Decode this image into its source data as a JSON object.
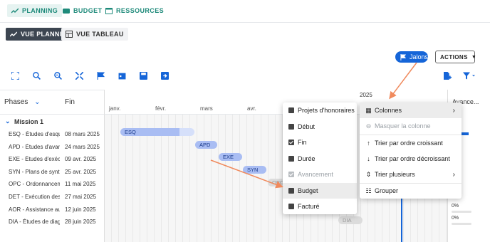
{
  "tabs": [
    {
      "label": "PLANNING",
      "icon": "trend-icon"
    },
    {
      "label": "BUDGET",
      "icon": "wallet-icon"
    },
    {
      "label": "RESSOURCES",
      "icon": "calendar-icon"
    }
  ],
  "views": {
    "gantt": "VUE PLANNING",
    "table": "VUE TABLEAU"
  },
  "toolbar": {
    "jalons": "Jalons",
    "actions": "ACTIONS"
  },
  "grid": {
    "phases_header": "Phases",
    "fin_header": "Fin",
    "year": "2025",
    "progress_header": "Avance...",
    "months": [
      "janv.",
      "févr.",
      "mars",
      "avr."
    ],
    "mission": "Mission 1",
    "rows": [
      {
        "phase": "ESQ - Études d'esquisse",
        "fin": "08 mars 2025",
        "bar": "ESQ"
      },
      {
        "phase": "APD - Études d'avant-projet",
        "fin": "24 mars 2025",
        "bar": "APD"
      },
      {
        "phase": "EXE - Études d'exécution",
        "fin": "09 avr. 2025",
        "bar": "EXE"
      },
      {
        "phase": "SYN - Plans de synthèse",
        "fin": "25 avr. 2025",
        "bar": "SYN"
      },
      {
        "phase": "OPC - Ordonnancement",
        "fin": "11 mai 2025",
        "bar": "OPC"
      },
      {
        "phase": "DET - Exécution des contrats",
        "fin": "27 mai 2025",
        "bar": ""
      },
      {
        "phase": "AOR - Assistance aux opérations",
        "fin": "12 juin 2025",
        "bar": ""
      },
      {
        "phase": "DIA - Études de diagnostic",
        "fin": "28 juin 2025",
        "bar": "DIA"
      }
    ],
    "progress": [
      "0%",
      "0%"
    ]
  },
  "column_menu": [
    {
      "label": "Projets d'honoraires",
      "checked": false,
      "dim": false
    },
    {
      "label": "Début",
      "checked": false,
      "dim": false
    },
    {
      "label": "Fin",
      "checked": true,
      "dim": false
    },
    {
      "label": "Durée",
      "checked": false,
      "dim": false
    },
    {
      "label": "Avancement",
      "checked": true,
      "dim": true
    },
    {
      "label": "Budget",
      "checked": false,
      "dim": false
    },
    {
      "label": "Facturé",
      "checked": false,
      "dim": false
    }
  ],
  "context_menu": {
    "colonnes": "Colonnes",
    "masquer": "Masquer la colonne",
    "asc": "Trier par ordre croissant",
    "desc": "Trier par ordre décroissant",
    "multi": "Trier plusieurs",
    "group": "Grouper"
  },
  "colors": {
    "accent": "#1e8a7a",
    "primary": "#1565d8",
    "bar": "#a9bdf3",
    "annotation": "#f08a5d"
  }
}
